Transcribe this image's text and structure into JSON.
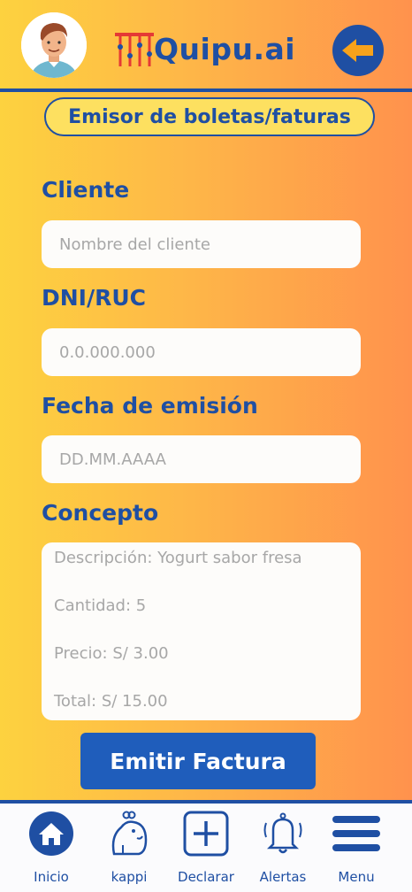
{
  "header": {
    "logo_text": "Quipu.ai",
    "avatar_icon": "user-avatar",
    "back_icon": "arrow-left-icon"
  },
  "page_title": "Emisor de boletas/faturas",
  "form": {
    "client_label": "Cliente",
    "client_placeholder": "Nombre del cliente",
    "id_label": "DNI/RUC",
    "id_placeholder": "0.0.000.000",
    "date_label": "Fecha de emisión",
    "date_placeholder": "DD.MM.AAAA",
    "concept_label": "Concepto",
    "concept_lines": [
      "Descripción:  Yogurt sabor fresa",
      "Cantidad: 5",
      "Precio: S/ 3.00",
      "Total: S/ 15.00"
    ],
    "submit_label": "Emitir Factura"
  },
  "nav": {
    "items": [
      {
        "label": "Inicio",
        "icon": "home-icon"
      },
      {
        "label": "kappi",
        "icon": "capybara-icon"
      },
      {
        "label": "Declarar",
        "icon": "plus-box-icon"
      },
      {
        "label": "Alertas",
        "icon": "bell-icon"
      },
      {
        "label": "Menu",
        "icon": "hamburger-icon"
      }
    ]
  },
  "colors": {
    "primary": "#1f4fa3",
    "button": "#1f5dbb",
    "gradient_left": "#fdd23f",
    "gradient_right": "#ff924d",
    "back_arrow": "#f7a21b"
  }
}
